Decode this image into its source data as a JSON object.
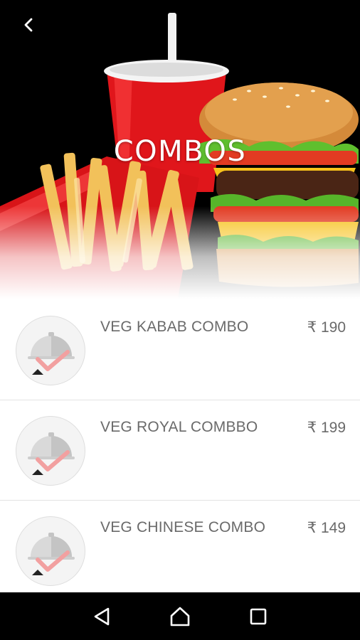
{
  "header": {
    "title": "COMBOS",
    "back_icon": "back-arrow-icon",
    "banner_image": "combo-meal-image"
  },
  "items": [
    {
      "name": "VEG KABAB COMBO",
      "price": "₹ 190",
      "icon": "food-cloche-icon"
    },
    {
      "name": "VEG ROYAL COMBBO",
      "price": "₹ 199",
      "icon": "food-cloche-icon"
    },
    {
      "name": "VEG CHINESE COMBO",
      "price": "₹ 149",
      "icon": "food-cloche-icon"
    }
  ],
  "navbar": {
    "back": "nav-back-icon",
    "home": "nav-home-icon",
    "recents": "nav-recents-icon"
  },
  "colors": {
    "text": "#6a6a6a",
    "divider": "#e3e3e3",
    "navbar": "#000000",
    "accent_check": "#f2a0a0"
  }
}
